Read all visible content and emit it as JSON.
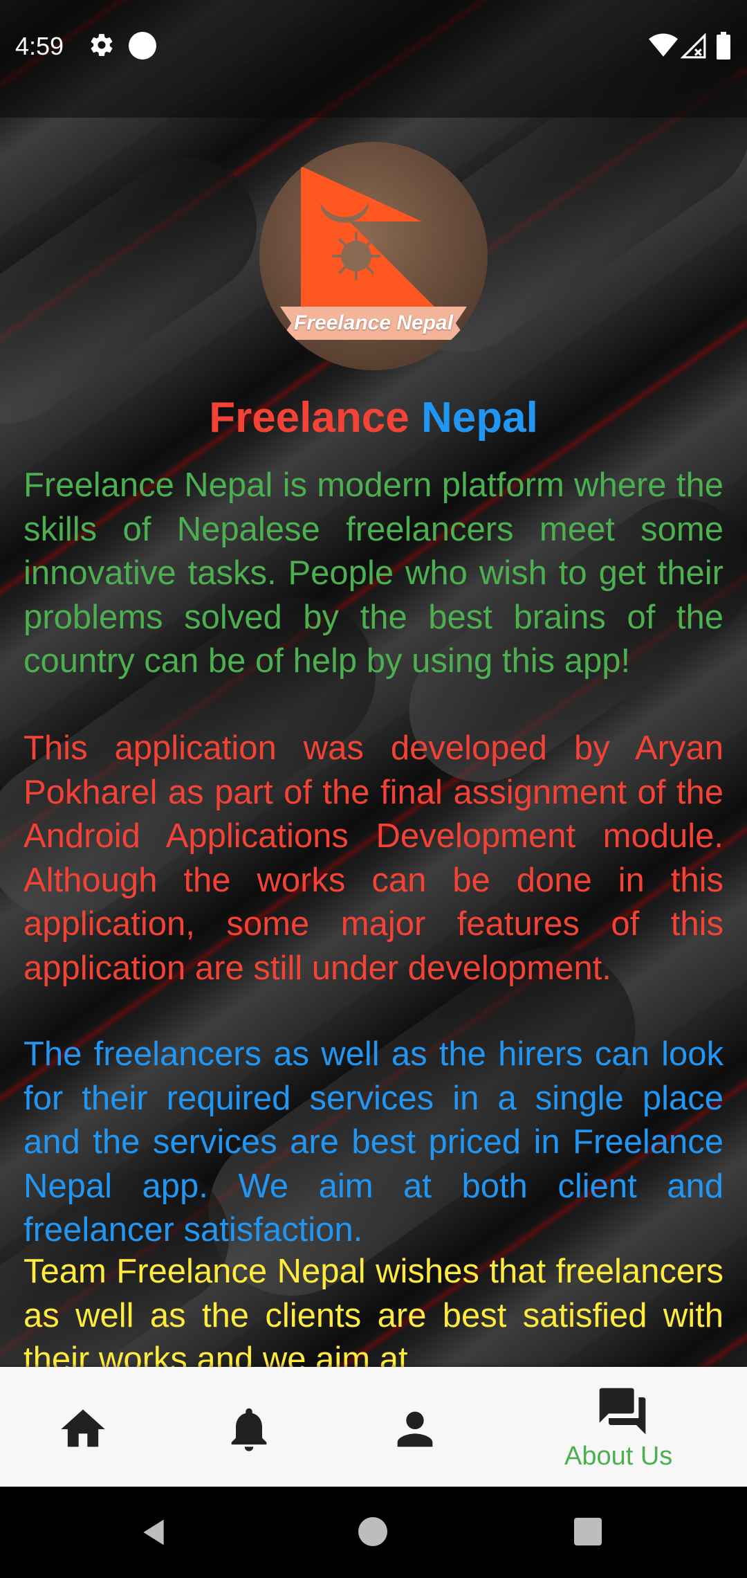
{
  "status_bar": {
    "time": "4:59",
    "icons": [
      "gear-icon",
      "circle-icon",
      "wifi-icon",
      "signal-icon",
      "battery-icon"
    ]
  },
  "logo": {
    "icon": "nepal-flag-logo",
    "banner_text": "Freelance Nepal"
  },
  "title": {
    "part1": "Freelance",
    "part2": "Nepal"
  },
  "paragraphs": [
    {
      "text": "Freelance Nepal is modern platform where the skills of Nepalese freelancers meet some innovative tasks. People who wish to get their problems solved by the best brains of the country can be of help by using this app!",
      "color": "#4caf50"
    },
    {
      "text": "This application was developed by Aryan Pokharel as part of the final assignment of the Android Applications Development module. Although the works can be done in this application, some major features of this application are still under development.",
      "color": "#f44336"
    },
    {
      "text": "The freelancers as well as the hirers can look for their required services in a single place and the services are best priced in Freelance Nepal app. We aim at both client and freelancer satisfaction.",
      "color": "#2196f3"
    },
    {
      "text": "Team Freelance Nepal wishes that freelancers as well as the clients are best satisfied with their works and we aim at",
      "color": "#ffeb3b"
    }
  ],
  "bottom_nav": {
    "items": [
      {
        "icon": "home-icon",
        "label": ""
      },
      {
        "icon": "bell-icon",
        "label": ""
      },
      {
        "icon": "person-icon",
        "label": ""
      },
      {
        "icon": "forum-icon",
        "label": "About Us",
        "active": true
      }
    ],
    "active_color": "#4caf50"
  },
  "system_nav": {
    "icons": [
      "back-icon",
      "home-circle-icon",
      "recents-icon"
    ]
  }
}
